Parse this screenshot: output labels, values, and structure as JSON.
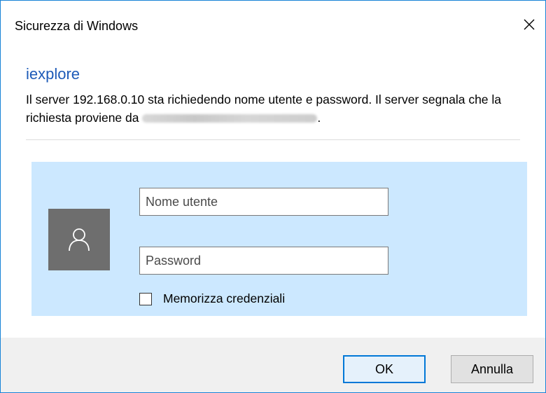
{
  "window": {
    "title": "Sicurezza di Windows",
    "close_icon": "close-icon"
  },
  "app_name": "iexplore",
  "message": {
    "text_before": "Il server 192.168.0.10 sta richiedendo nome utente e password. Il server segnala che la richiesta proviene da ",
    "redacted_realm": "Panasonic network device",
    "text_after": "."
  },
  "credentials": {
    "user_icon": "user-icon",
    "username": {
      "placeholder": "Nome utente",
      "value": ""
    },
    "password": {
      "placeholder": "Password",
      "value": ""
    },
    "remember": {
      "label": "Memorizza credenziali",
      "checked": false
    }
  },
  "buttons": {
    "ok_label": "OK",
    "cancel_label": "Annulla"
  },
  "colors": {
    "accent": "#0078d7",
    "title_blue": "#1e5bb8",
    "panel_bg": "#cce8ff",
    "tile_bg": "#6e6e6e",
    "footer_bg": "#f0f0f0"
  }
}
